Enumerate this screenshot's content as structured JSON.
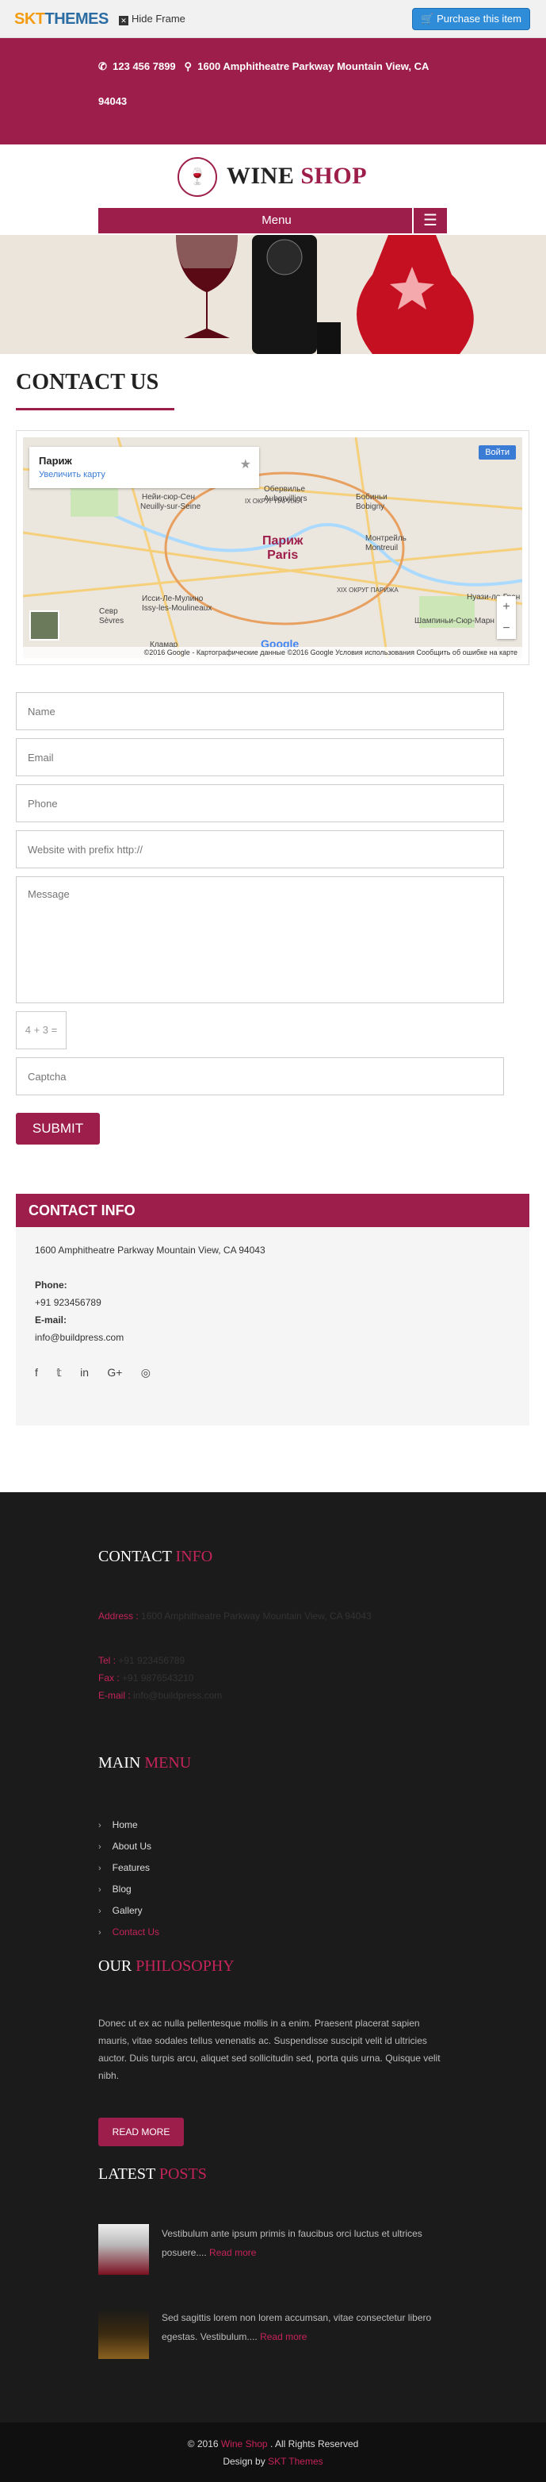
{
  "topbar": {
    "logo_skt": "SKT",
    "logo_themes": "THEMES",
    "hide_frame": "Hide Frame",
    "purchase": "Purchase this item"
  },
  "header": {
    "phone": "123 456 7899",
    "address": "1600 Amphitheatre Parkway Mountain View, CA 94043"
  },
  "brand": {
    "wine": "WINE",
    "shop": "SHOP"
  },
  "menu": {
    "label": "Menu"
  },
  "page": {
    "title": "CONTACT US"
  },
  "map": {
    "place": "Париж",
    "enlarge": "Увеличить карту",
    "login": "Войти",
    "city_ru": "Париж",
    "city_en": "Paris",
    "google": "Google",
    "footer": "©2016 Google - Картографические данные ©2016 Google    Условия использования    Сообщить об ошибке на карте",
    "labels": [
      "Нейи-сюр-Сен",
      "Neuilly-sur-Seine",
      "IX ОКРУГ ПАРИЖА",
      "Иcси-Ле-Мулино",
      "Issy-les-Moulineaux",
      "Монтрейль",
      "Montreuil",
      "Бобиньи",
      "Bobigny",
      "Севр",
      "Sèvres",
      "Кламар",
      "XIX ОКРУГ ПАРИЖА",
      "Шампиньи-Сюр-Марн",
      "Нуази-ле-Гран",
      "Обервилье",
      "Aubervilliers"
    ]
  },
  "form": {
    "name": "Name",
    "email": "Email",
    "phone": "Phone",
    "website": "Website with prefix http://",
    "message": "Message",
    "captcha_q": "4 + 3 =",
    "captcha": "Captcha",
    "submit": "SUBMIT"
  },
  "contact_info": {
    "title": "CONTACT INFO",
    "address": "1600 Amphitheatre Parkway Mountain View, CA 94043",
    "phone_label": "Phone:",
    "phone": "+91 923456789",
    "email_label": "E-mail:",
    "email": "info@buildpress.com"
  },
  "footer": {
    "contact_title_1": "CONTACT",
    "contact_title_2": "INFO",
    "address_label": "Address :",
    "address": "1600 Amphitheatre Parkway Mountain View, CA 94043",
    "tel_label": "Tel :",
    "tel": "+91 923456789",
    "fax_label": "Fax :",
    "fax": "+91 9876543210",
    "email_label": "E-mail :",
    "email": "info@buildpress.com",
    "menu_title_1": "MAIN",
    "menu_title_2": "MENU",
    "menu_items": [
      "Home",
      "About Us",
      "Features",
      "Blog",
      "Gallery",
      "Contact Us"
    ],
    "phil_title_1": "OUR",
    "phil_title_2": "PHILOSOPHY",
    "phil_text": "Donec ut ex ac nulla pellentesque mollis in a enim. Praesent placerat sapien mauris, vitae sodales tellus venenatis ac. Suspendisse suscipit velit id ultricies auctor. Duis turpis arcu, aliquet sed sollicitudin sed, porta quis urna. Quisque velit nibh.",
    "read_more": "READ MORE",
    "posts_title_1": "LATEST",
    "posts_title_2": "POSTS",
    "posts": [
      {
        "text": "Vestibulum ante ipsum primis in faucibus orci luctus et ultrices posuere....",
        "more": "Read more"
      },
      {
        "text": "Sed sagittis lorem non lorem accumsan, vitae consectetur libero egestas. Vestibulum....",
        "more": "Read more"
      }
    ]
  },
  "copyright": {
    "pre": "© 2016",
    "site": "Wine Shop",
    "post": ". All Rights Reserved",
    "design_pre": "Design by",
    "design": "SKT Themes"
  },
  "colors": {
    "accent": "#9d1e4a",
    "footer_bg": "#1b1b1b"
  }
}
